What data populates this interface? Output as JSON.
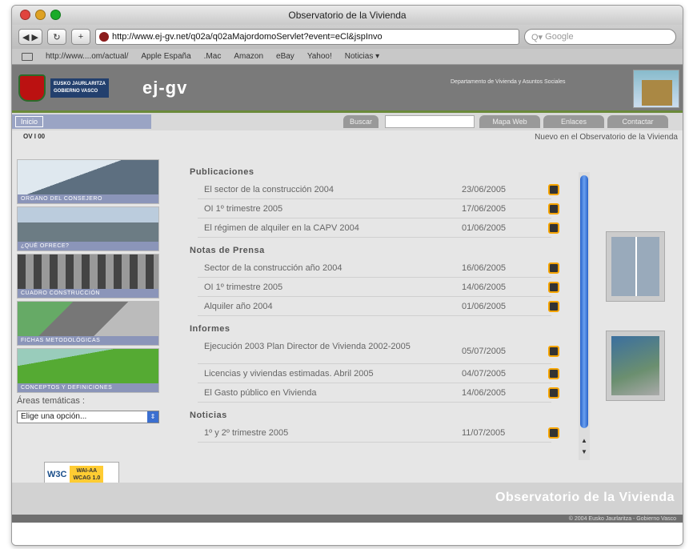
{
  "window": {
    "title": "Observatorio de la Vivienda"
  },
  "browser": {
    "url": "http://www.ej-gv.net/q02a/q02aMajordomoServlet?event=eCl&jspInvo",
    "search_placeholder": "Google",
    "bookmarks": [
      "http://www....om/actual/",
      "Apple España",
      ".Mac",
      "Amazon",
      "eBay",
      "Yahoo!",
      "Noticias ▾"
    ]
  },
  "header": {
    "gov_line1": "EUSKO JAURLARITZA",
    "gov_line2": "GOBIERNO VASCO",
    "brand": "ej-gv",
    "dept_text": "Departamento de Vivienda y Asuntos Sociales"
  },
  "nav": {
    "home": "Inicio",
    "search_label": "Buscar",
    "buttons": [
      "Mapa Web",
      "Enlaces",
      "Contactar"
    ]
  },
  "sub": {
    "breadcrumb": "OV I 00",
    "tagline": "Nuevo en el Observatorio de la Vivienda"
  },
  "sidebar": {
    "blocks": [
      "ORGANO DEL CONSEJERO",
      "¿QUÉ OFRECE?",
      "CUADRO CONSTRUCCIÓN",
      "FICHAS METODOLÓGICAS",
      "CONCEPTOS Y DEFINICIONES"
    ],
    "areas_label": "Áreas temáticas :",
    "select_value": "Elige una opción...",
    "w3c": {
      "logo": "W3C",
      "badge1": "WAI-AA",
      "badge2": "WCAG 1.0"
    }
  },
  "sections": [
    {
      "title": "Publicaciones",
      "rows": [
        {
          "t": "El sector de la construcción 2004",
          "d": "23/06/2005"
        },
        {
          "t": "OI 1º trimestre 2005",
          "d": "17/06/2005"
        },
        {
          "t": "El régimen de alquiler en la CAPV 2004",
          "d": "01/06/2005"
        }
      ]
    },
    {
      "title": "Notas de Prensa",
      "rows": [
        {
          "t": "Sector de la construcción año 2004",
          "d": "16/06/2005"
        },
        {
          "t": "OI 1º trimestre 2005",
          "d": "14/06/2005"
        },
        {
          "t": "Alquiler año 2004",
          "d": "01/06/2005"
        }
      ]
    },
    {
      "title": "Informes",
      "rows": [
        {
          "t": "Ejecución 2003 Plan Director de Vivienda 2002-2005",
          "d": "05/07/2005",
          "tall": true
        },
        {
          "t": "Licencias y viviendas estimadas. Abril 2005",
          "d": "04/07/2005"
        },
        {
          "t": "El Gasto público en Vivienda",
          "d": "14/06/2005"
        }
      ]
    },
    {
      "title": "Noticias",
      "rows": [
        {
          "t": "1º y 2º trimestre 2005",
          "d": "11/07/2005"
        }
      ]
    }
  ],
  "footer": {
    "logo": "Observatorio de la Vivienda",
    "copyright": "© 2004 Eusko Jaurlaritza - Gobierno Vasco"
  }
}
